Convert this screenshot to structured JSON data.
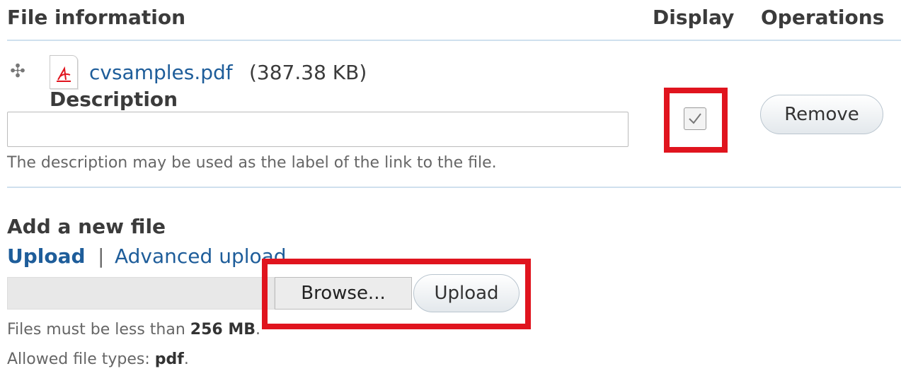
{
  "table": {
    "header_file": "File information",
    "header_display": "Display",
    "header_operations": "Operations"
  },
  "file": {
    "name": "cvsamples.pdf",
    "size": "(387.38 KB)",
    "description_label": "Description",
    "description_value": "",
    "description_help": "The description may be used as the label of the link to the file.",
    "display_checked": true,
    "remove_label": "Remove",
    "icon": "pdf-file-icon"
  },
  "add_file": {
    "title": "Add a new file",
    "tab_upload": "Upload",
    "separator": "|",
    "tab_advanced": "Advanced upload",
    "browse_label": "Browse...",
    "upload_label": "Upload",
    "size_limit_prefix": "Files must be less than",
    "size_limit_value": "256 MB",
    "size_limit_suffix": ".",
    "types_prefix": "Allowed file types:",
    "types_value": "pdf",
    "types_suffix": "."
  },
  "colors": {
    "link": "#1e5d9a",
    "highlight": "#e0141e",
    "rule": "#cfe0ee"
  }
}
